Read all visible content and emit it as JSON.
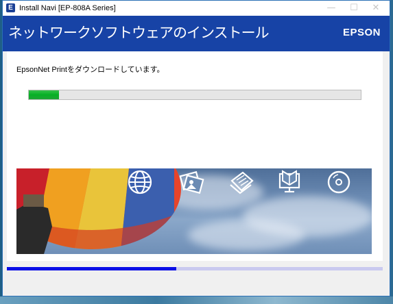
{
  "window": {
    "title": "Install Navi [EP-808A Series]",
    "icon_letter": "E",
    "controls": {
      "minimize": "—",
      "maximize": "☐",
      "close": "✕"
    }
  },
  "header": {
    "title": "ネットワークソフトウェアのインストール",
    "brand": "EPSON"
  },
  "main": {
    "status": "EpsonNet Printをダウンロードしています。",
    "download_progress_percent": 9
  },
  "banner": {
    "icons": [
      "globe-icon",
      "photo-icon",
      "document-icon",
      "screen-book-icon",
      "cd-icon"
    ]
  },
  "overall_progress_percent": 45,
  "colors": {
    "header_bg": "#1743a6",
    "progress_green": "#06b025",
    "overall_progress": "#0a0ee6"
  }
}
